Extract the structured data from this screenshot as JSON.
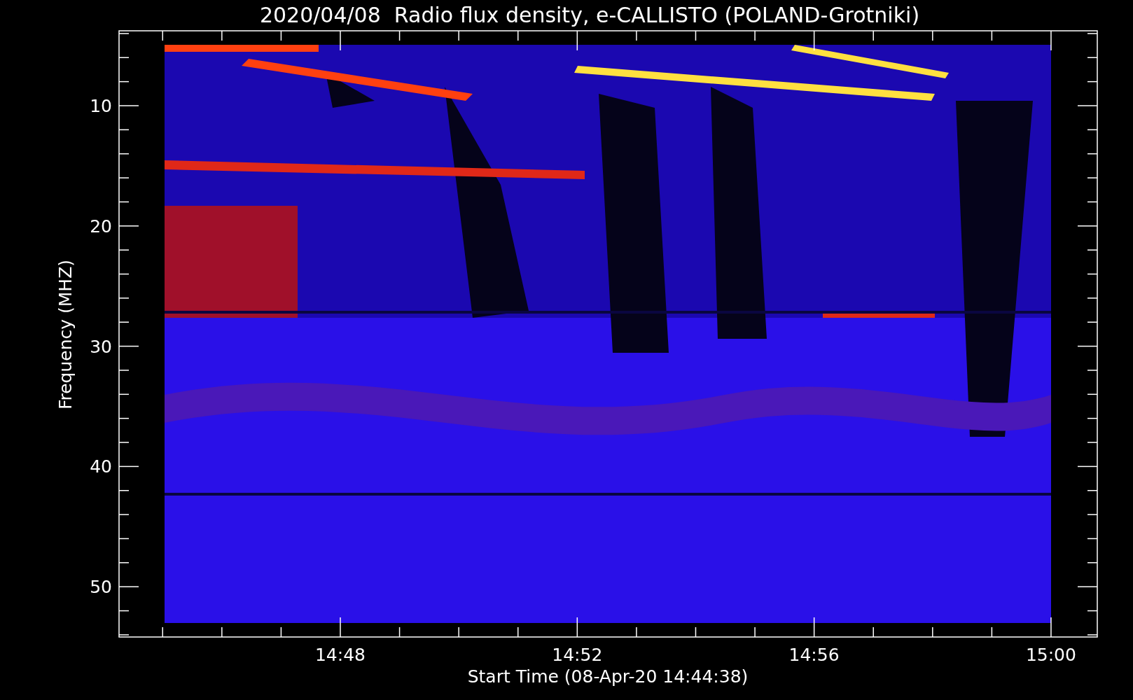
{
  "title": "2020/04/08  Radio flux density, e-CALLISTO (POLAND-Grotniki)",
  "y_axis": {
    "label": "Frequency (MHZ)",
    "tick_labels": [
      "10",
      "20",
      "30",
      "40",
      "50"
    ]
  },
  "x_axis": {
    "label": "Start Time (08-Apr-20 14:44:38)",
    "tick_labels": [
      "14:48",
      "14:52",
      "14:56",
      "15:00"
    ]
  },
  "plot": {
    "kind": "spectrogram"
  }
}
